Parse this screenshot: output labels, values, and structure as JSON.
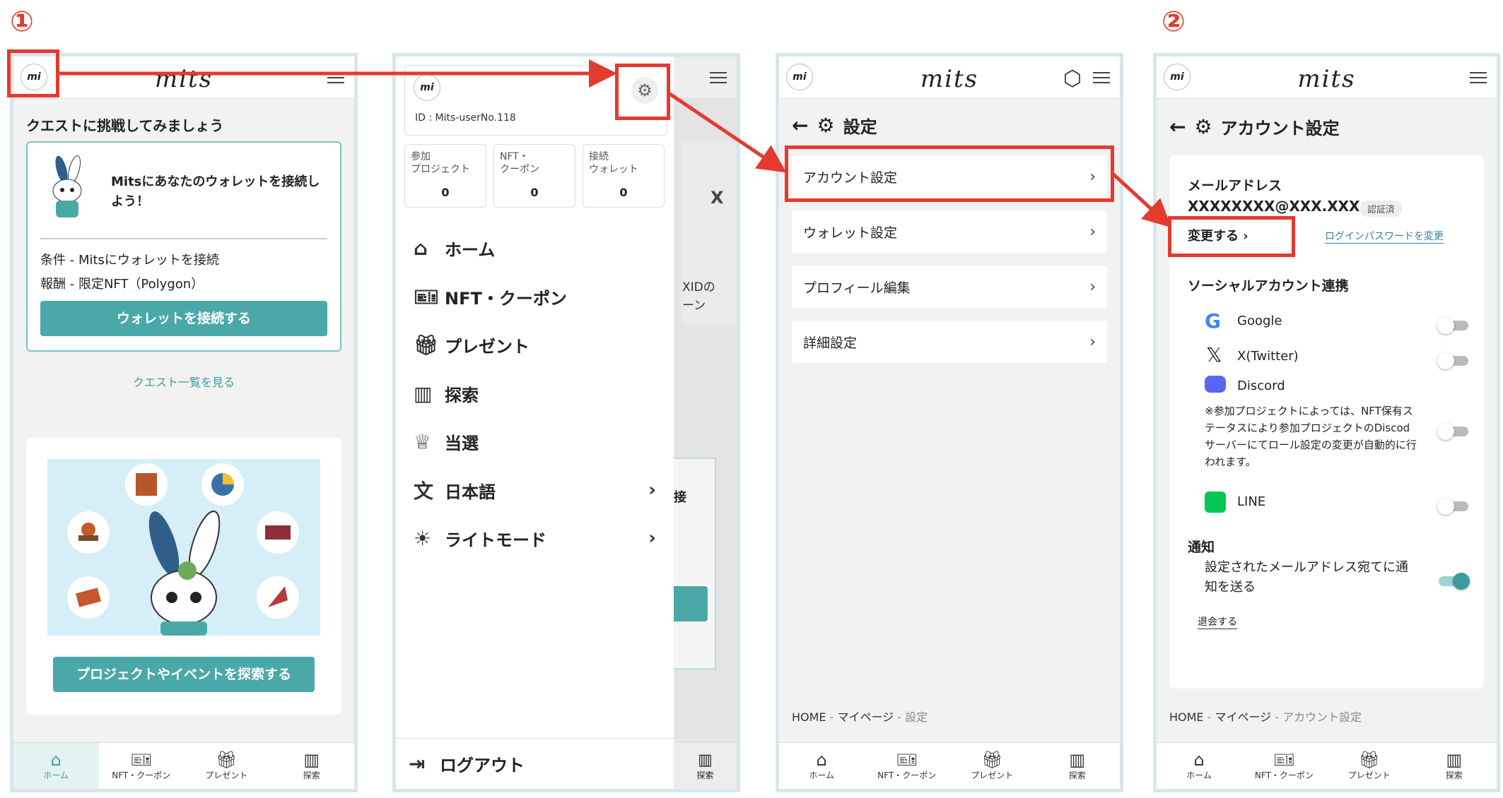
{
  "steps": {
    "one": "①",
    "two": "②"
  },
  "app": {
    "logo": "mits",
    "avatar": "mi"
  },
  "bottom_nav": [
    {
      "label": "ホーム",
      "icon": "home-icon"
    },
    {
      "label": "NFT・クーポン",
      "icon": "ticket-icon"
    },
    {
      "label": "プレゼント",
      "icon": "gift-icon"
    },
    {
      "label": "探索",
      "icon": "map-icon"
    }
  ],
  "home": {
    "quest_heading": "クエストに挑戦してみましょう",
    "card_title": "Mitsにあなたのウォレットを接続しよう！",
    "condition": "条件 - Mitsにウォレットを接続",
    "reward": "報酬 - 限定NFT（Polygon）",
    "connect_button": "ウォレットを接続する",
    "quest_list_link": "クエスト一覧を見る",
    "explore_button": "プロジェクトやイベントを探索する"
  },
  "drawer": {
    "user_id": "ID : Mits-userNo.118",
    "stats": [
      {
        "label": "参加\nプロジェクト",
        "value": "0"
      },
      {
        "label": "NFT・\nクーポン",
        "value": "0"
      },
      {
        "label": "接続\nウォレット",
        "value": "0"
      }
    ],
    "menu": [
      {
        "label": "ホーム",
        "icon": "home-icon"
      },
      {
        "label": "NFT・クーポン",
        "icon": "ticket-icon"
      },
      {
        "label": "プレゼント",
        "icon": "gift-icon"
      },
      {
        "label": "探索",
        "icon": "map-icon"
      },
      {
        "label": "当選",
        "icon": "trophy-icon"
      },
      {
        "label": "日本語",
        "icon": "translate-icon"
      },
      {
        "label": "ライトモード",
        "icon": "sun-icon"
      }
    ],
    "logout": "ログアウト",
    "peek_text_1": "XIDの",
    "peek_text_2": "ーン",
    "peek_text_3": "接",
    "peek_nav": "探索"
  },
  "settings": {
    "title": "設定",
    "items": [
      "アカウント設定",
      "ウォレット設定",
      "プロフィール編集",
      "詳細設定"
    ],
    "breadcrumb": {
      "home": "HOME",
      "mypage": "マイページ",
      "current": "設定"
    }
  },
  "account": {
    "title": "アカウント設定",
    "email_label": "メールアドレス",
    "email_value": "XXXXXXXX@XXX.XXX",
    "verified": "認証済",
    "change_button": "変更する",
    "password_link": "ログインパスワードを変更",
    "social_heading": "ソーシャルアカウント連携",
    "social": [
      {
        "name": "Google",
        "icon": "google-icon"
      },
      {
        "name": "X(Twitter)",
        "icon": "x-twitter-icon"
      },
      {
        "name": "Discord",
        "icon": "discord-icon"
      },
      {
        "name": "LINE",
        "icon": "line-icon"
      }
    ],
    "discord_note": "※参加プロジェクトによっては、NFT保有ステータスにより参加プロジェクトのDiscodサーバーにてロール設定の変更が自動的に行われます。",
    "notify_heading": "通知",
    "notify_text": "設定されたメールアドレス宛てに通知を送る",
    "withdraw": "退会する",
    "breadcrumb": {
      "home": "HOME",
      "mypage": "マイページ",
      "current": "アカウント設定"
    }
  },
  "colors": {
    "accent": "#4aa9a8",
    "annotation": "#e53a2f"
  }
}
